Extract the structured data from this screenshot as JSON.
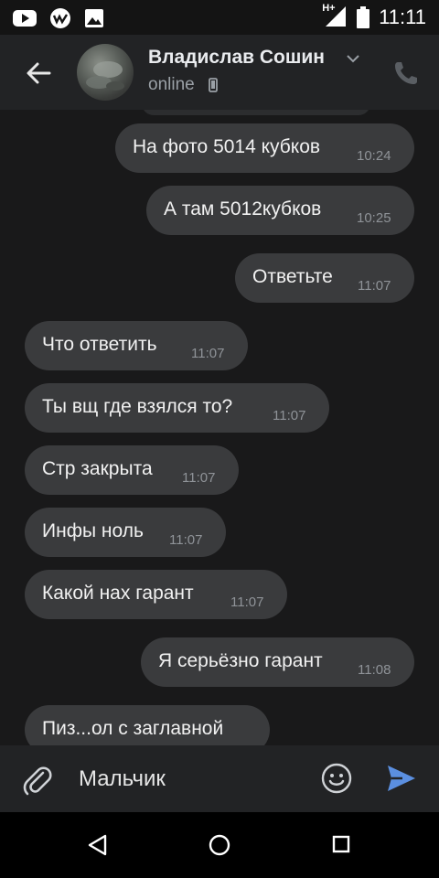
{
  "status_bar": {
    "time": "11:11",
    "network": "H+",
    "left_icons": [
      "youtube-icon",
      "app-icon",
      "image-icon"
    ]
  },
  "header": {
    "name": "Владислав Сошин",
    "status": "online"
  },
  "messages": [
    {
      "text": "На фото 5014 кубков",
      "time": "10:24",
      "dir": "out"
    },
    {
      "text": "А там 5012кубков",
      "time": "10:25",
      "dir": "out"
    },
    {
      "text": "Ответьте",
      "time": "11:07",
      "dir": "out"
    },
    {
      "text": "Что ответить",
      "time": "11:07",
      "dir": "in"
    },
    {
      "text": "Ты вщ где взялся то?",
      "time": "11:07",
      "dir": "in"
    },
    {
      "text": "Стр закрыта",
      "time": "11:07",
      "dir": "in"
    },
    {
      "text": "Инфы ноль",
      "time": "11:07",
      "dir": "in"
    },
    {
      "text": "Какой нах гарант",
      "time": "11:07",
      "dir": "in"
    },
    {
      "text": "Я серьёзно гарант",
      "time": "11:08",
      "dir": "out"
    },
    {
      "text": "Пиз...ол с заглавной",
      "time": "",
      "dir": "in"
    }
  ],
  "composer": {
    "text": "Мальчик"
  },
  "colors": {
    "send": "#5b8fe0",
    "bubble": "#3a3b3d",
    "background": "#19191a",
    "header": "#222325"
  }
}
